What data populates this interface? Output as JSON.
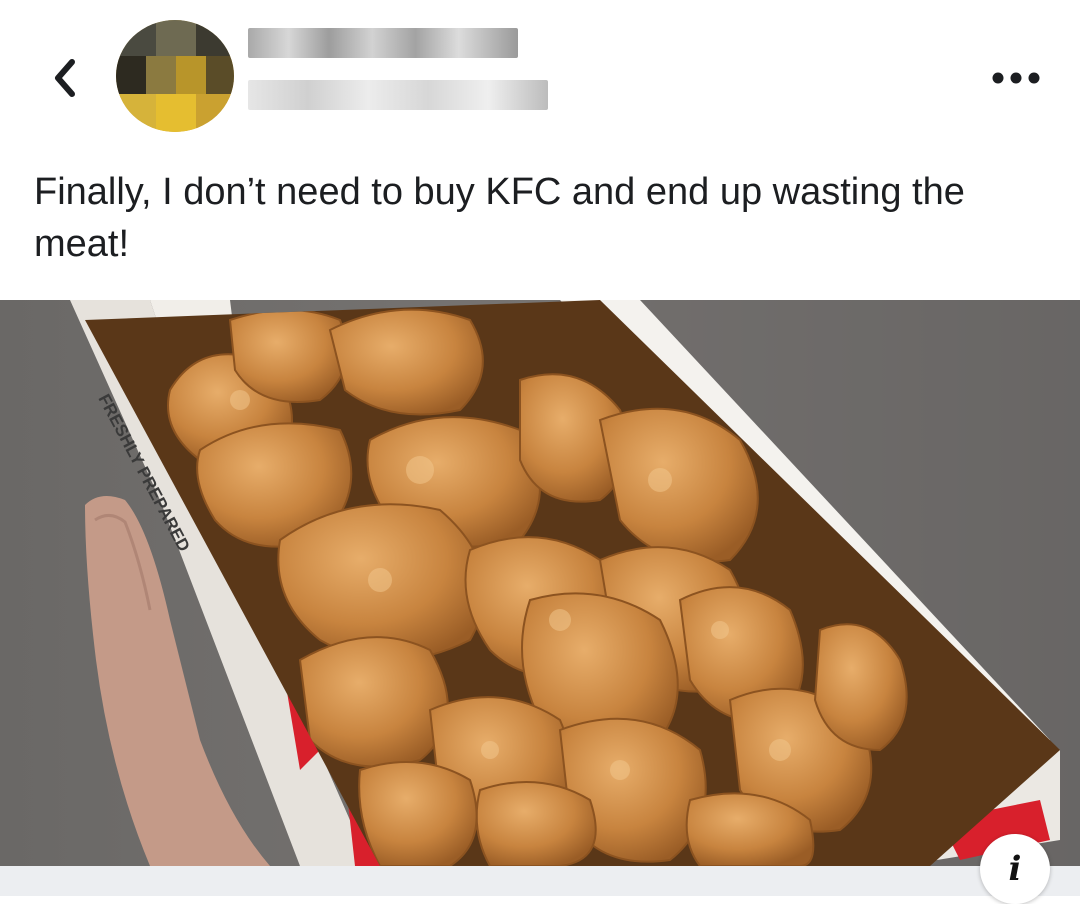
{
  "header": {
    "back_icon": "chevron-left-icon",
    "more_icon": "more-horizontal-icon"
  },
  "post": {
    "caption": "Finally, I don’t need to buy KFC and end up wasting the meat!",
    "box_print": "FRESHLY PREPARED"
  },
  "info": {
    "label": "i"
  },
  "colors": {
    "text": "#1c1e21",
    "box_red": "#d8202c",
    "footer_bg": "#eceef1"
  }
}
